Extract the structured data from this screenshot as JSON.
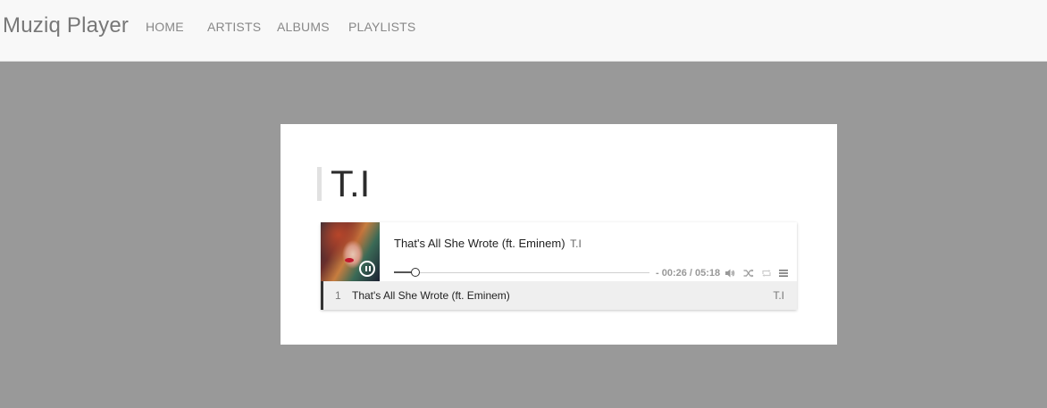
{
  "navbar": {
    "brand": "Muziq Player",
    "links": [
      {
        "label": "HOME"
      },
      {
        "label": "ARTISTS"
      },
      {
        "label": "ALBUMS"
      },
      {
        "label": "PLAYLISTS"
      }
    ]
  },
  "page": {
    "artist_heading": "T.I"
  },
  "player": {
    "now_playing": {
      "title": "That's All She Wrote (ft. Eminem)",
      "artist": "T.I"
    },
    "time_display": "- 00:26 / 05:18",
    "progress_fraction": 0.0818,
    "controls": {
      "play_pause_icon": "pause-icon",
      "volume_icon": "volume-icon",
      "shuffle_icon": "shuffle-icon",
      "repeat_icon": "repeat-icon",
      "playlist_icon": "playlist-menu-icon"
    },
    "playlist": [
      {
        "number": "1",
        "title": "That's All She Wrote (ft. Eminem)",
        "artist": "T.I"
      }
    ]
  },
  "colors": {
    "background": "#999999",
    "navbar": "#f8f8f8",
    "card": "#ffffff",
    "active_row": "#efefef",
    "active_marker": "#333333"
  }
}
